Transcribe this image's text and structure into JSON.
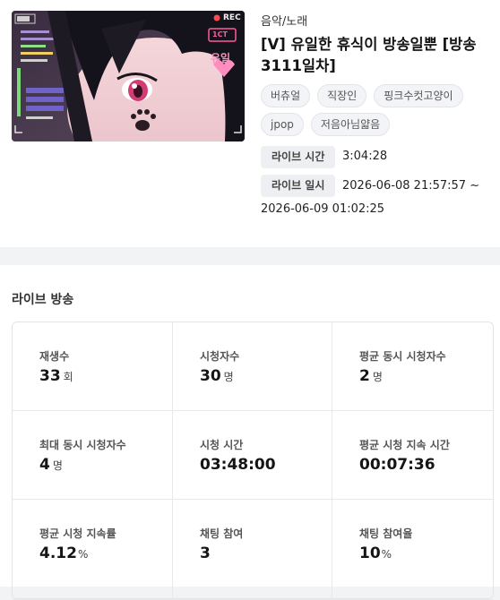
{
  "video": {
    "thumbnail": {
      "rec_label": "REC",
      "badge": "1CT",
      "caption": "유일"
    },
    "category": "음악/노래",
    "title": "[V] 유일한 휴식이 방송일뿐 [방송 3111일차]",
    "tags": [
      "버츄얼",
      "직장인",
      "핑크수컷고양이",
      "jpop",
      "저음아님얇음"
    ],
    "live_time_label": "라이브 시간",
    "live_time_value": "3:04:28",
    "live_date_label": "라이브 일시",
    "live_date_value_line1": "2026-06-08 21:57:57 ~",
    "live_date_value_line2": "2026-06-09 01:02:25"
  },
  "stats": {
    "section_title": "라이브 방송",
    "items": [
      {
        "label": "재생수",
        "value": "33",
        "unit": "회"
      },
      {
        "label": "시청자수",
        "value": "30",
        "unit": "명"
      },
      {
        "label": "평균 동시 시청자수",
        "value": "2",
        "unit": "명"
      },
      {
        "label": "최대 동시 시청자수",
        "value": "4",
        "unit": "명"
      },
      {
        "label": "시청 시간",
        "value": "03:48:00",
        "unit": ""
      },
      {
        "label": "평균 시청 지속 시간",
        "value": "00:07:36",
        "unit": ""
      },
      {
        "label": "평균 시청 지속률",
        "value": "4.12",
        "unit": "%"
      },
      {
        "label": "채팅 참여",
        "value": "3",
        "unit": ""
      },
      {
        "label": "채팅 참여율",
        "value": "10",
        "unit": "%"
      }
    ]
  },
  "colors": {
    "rec_dot": "#ff4b4b",
    "badge": "#ff5aa0",
    "eye": "#d23c74",
    "hair": "#14121a"
  }
}
